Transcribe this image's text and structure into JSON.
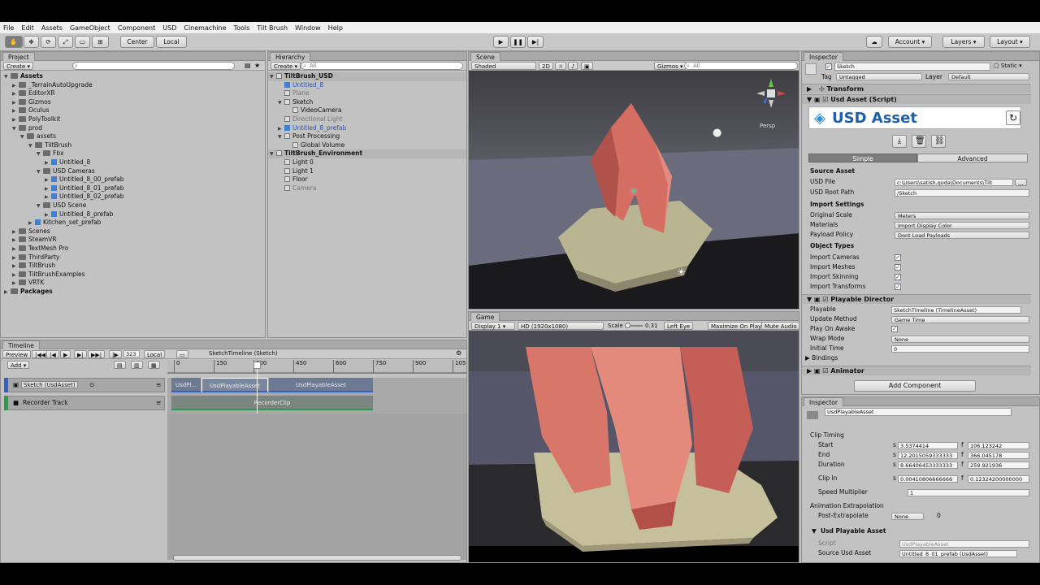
{
  "menu": [
    "File",
    "Edit",
    "Assets",
    "GameObject",
    "Component",
    "USD",
    "Cinemachine",
    "Tools",
    "Tilt Brush",
    "Window",
    "Help"
  ],
  "toolbar": {
    "pivot": "Center",
    "space": "Local",
    "account": "Account",
    "layers": "Layers",
    "layout": "Layout"
  },
  "project": {
    "tab": "Project",
    "create": "Create",
    "tree": [
      {
        "label": "Assets",
        "depth": 0,
        "bold": true,
        "arrow": "▼"
      },
      {
        "label": "_TerrainAutoUpgrade",
        "depth": 1,
        "arrow": "▶"
      },
      {
        "label": "EditorXR",
        "depth": 1,
        "arrow": "▶"
      },
      {
        "label": "Gizmos",
        "depth": 1,
        "arrow": "▶"
      },
      {
        "label": "Oculus",
        "depth": 1,
        "arrow": "▶"
      },
      {
        "label": "PolyToolkit",
        "depth": 1,
        "arrow": "▶"
      },
      {
        "label": "prod",
        "depth": 1,
        "arrow": "▼"
      },
      {
        "label": "assets",
        "depth": 2,
        "arrow": "▼"
      },
      {
        "label": "TiltBrush",
        "depth": 3,
        "arrow": "▼"
      },
      {
        "label": "Fbx",
        "depth": 4,
        "arrow": "▼"
      },
      {
        "label": "Untitled_8",
        "depth": 5,
        "arrow": "▶",
        "cube": true
      },
      {
        "label": "USD Cameras",
        "depth": 4,
        "arrow": "▼"
      },
      {
        "label": "Untitled_8_00_prefab",
        "depth": 5,
        "arrow": "▶",
        "cube": true
      },
      {
        "label": "Untitled_8_01_prefab",
        "depth": 5,
        "arrow": "▶",
        "cube": true
      },
      {
        "label": "Untitled_8_02_prefab",
        "depth": 5,
        "arrow": "▶",
        "cube": true
      },
      {
        "label": "USD Scene",
        "depth": 4,
        "arrow": "▼"
      },
      {
        "label": "Untitled_8_prefab",
        "depth": 5,
        "arrow": "▶",
        "cube": true
      },
      {
        "label": "Kitchen_set_prefab",
        "depth": 3,
        "arrow": "▶",
        "cube": true
      },
      {
        "label": "Scenes",
        "depth": 1,
        "arrow": "▶"
      },
      {
        "label": "SteamVR",
        "depth": 1,
        "arrow": "▶"
      },
      {
        "label": "TextMesh Pro",
        "depth": 1,
        "arrow": "▶"
      },
      {
        "label": "ThirdParty",
        "depth": 1,
        "arrow": "▶"
      },
      {
        "label": "TiltBrush",
        "depth": 1,
        "arrow": "▶"
      },
      {
        "label": "TiltBrushExamples",
        "depth": 1,
        "arrow": "▶"
      },
      {
        "label": "VRTK",
        "depth": 1,
        "arrow": "▶"
      },
      {
        "label": "Packages",
        "depth": 0,
        "bold": true,
        "arrow": "▶"
      }
    ]
  },
  "hierarchy": {
    "tab": "Hierarchy",
    "create": "Create",
    "search_placeholder": "All",
    "rows": [
      {
        "label": "TiltBrush_USD",
        "depth": 0,
        "arrow": "▼",
        "style": "scene"
      },
      {
        "label": "Untitled_8",
        "depth": 1,
        "style": "blue"
      },
      {
        "label": "Plane",
        "depth": 1,
        "style": "grey"
      },
      {
        "label": "Sketch",
        "depth": 1,
        "arrow": "▼",
        "style": "normal"
      },
      {
        "label": "VideoCamera",
        "depth": 2,
        "style": "normal"
      },
      {
        "label": "Directional Light",
        "depth": 1,
        "style": "grey"
      },
      {
        "label": "Untitled_8_prefab",
        "depth": 1,
        "arrow": "▶",
        "style": "blue"
      },
      {
        "label": "Post Processing",
        "depth": 1,
        "arrow": "▼",
        "style": "normal"
      },
      {
        "label": "Global Volume",
        "depth": 2,
        "style": "normal"
      },
      {
        "label": "TiltBrush_Environment",
        "depth": 0,
        "arrow": "▼",
        "style": "scene"
      },
      {
        "label": "Light 0",
        "depth": 1,
        "style": "normal"
      },
      {
        "label": "Light 1",
        "depth": 1,
        "style": "normal"
      },
      {
        "label": "Floor",
        "depth": 1,
        "style": "normal"
      },
      {
        "label": "Camera",
        "depth": 1,
        "style": "grey"
      }
    ]
  },
  "scene": {
    "tab": "Scene",
    "shading": "Shaded",
    "mode2d": "2D",
    "gizmos": "Gizmos",
    "search_placeholder": "All",
    "persp": "Persp"
  },
  "game": {
    "tab": "Game",
    "display": "Display 1",
    "resolution": "HD (1920x1080)",
    "scale_label": "Scale",
    "scale_value": "0.31",
    "left_eye": "Left Eye",
    "maximize": "Maximize On Play",
    "mute": "Mute Audio"
  },
  "timeline": {
    "tab": "Timeline",
    "preview": "Preview",
    "frame": "323",
    "mode": "Local",
    "add": "Add",
    "asset_name": "SketchTimeline (Sketch)",
    "ruler": [
      "0",
      "150",
      "300",
      "450",
      "600",
      "750",
      "900",
      "1050"
    ],
    "tracks": [
      "Sketch (UsdAsset)",
      "Recorder Track"
    ],
    "clips": [
      {
        "label": "UsdPl..."
      },
      {
        "label": "UsdPlayableAsset"
      },
      {
        "label": "UsdPlayableAsset"
      },
      {
        "label": "RecorderClip"
      }
    ]
  },
  "inspector": {
    "tab": "Inspector",
    "object_name": "Sketch",
    "static": "Static",
    "tag_label": "Tag",
    "tag": "Untagged",
    "layer_label": "Layer",
    "layer": "Default",
    "transform": "Transform",
    "usd_asset_script": "Usd Asset (Script)",
    "usd_asset_title": "USD Asset",
    "tab_simple": "Simple",
    "tab_advanced": "Advanced",
    "source_asset": "Source Asset",
    "usd_file_label": "USD File",
    "usd_file": "c:\\Users\\satish.goda\\Documents\\Tilt",
    "usd_root_label": "USD Root Path",
    "usd_root": "/Sketch",
    "import_settings": "Import Settings",
    "orig_scale_label": "Original Scale",
    "orig_scale": "Meters",
    "materials_label": "Materials",
    "materials": "Import Display Color",
    "payload_label": "Payload Policy",
    "payload": "Dont Load Payloads",
    "object_types": "Object Types",
    "import_cameras": "Import Cameras",
    "import_meshes": "Import Meshes",
    "import_skinning": "Import Skinning",
    "import_transforms": "Import Transforms",
    "playable_director": "Playable Director",
    "playable_label": "Playable",
    "playable": "SketchTimeline (TimelineAsset)",
    "update_label": "Update Method",
    "update": "Game Time",
    "play_awake_label": "Play On Awake",
    "wrap_label": "Wrap Mode",
    "wrap": "None",
    "initial_time_label": "Initial Time",
    "initial_time": "0",
    "bindings": "Bindings",
    "animator": "Animator",
    "add_component": "Add Component"
  },
  "inspector2": {
    "tab": "Inspector",
    "name": "UsdPlayableAsset",
    "clip_timing": "Clip Timing",
    "start_label": "Start",
    "start_s": "3.5374414",
    "start_f": "106.123242",
    "end_label": "End",
    "end_s": "12.2015059333333",
    "end_f": "366.045178",
    "duration_label": "Duration",
    "duration_s": "8.66406453333333",
    "duration_f": "259.921936",
    "clipin_label": "Clip In",
    "clipin_s": "0.00410806666666",
    "clipin_f": "0.12324200000000",
    "speed_label": "Speed Multiplier",
    "speed": "1",
    "anim_extrap": "Animation Extrapolation",
    "post_label": "Post-Extrapolate",
    "post": "None",
    "post_value": "0",
    "usd_playable_asset": "Usd Playable Asset",
    "script_label": "Script",
    "script": "UsdPlayableAsset",
    "source_usd_label": "Source Usd Asset",
    "source_usd": "Untitled_8_01_prefab (UsdAsset)",
    "unit_s": "s",
    "unit_f": "f"
  }
}
